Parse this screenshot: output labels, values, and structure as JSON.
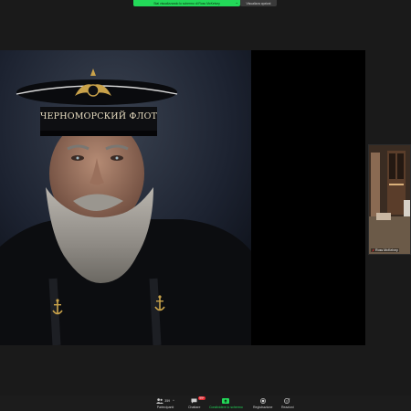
{
  "share_bar": {
    "banner_text": "Stai visualizzando lo schermo di Ross McKelvey",
    "view_options_label": "Visualizza opzioni"
  },
  "shared_content": {
    "cap_text": "ЧЕРНОМОРСКИЙ ФЛОТ"
  },
  "participant": {
    "name": "Ross McKelvey",
    "mic_muted": true
  },
  "toolbar": {
    "participants_label": "Partecipanti",
    "participants_count": "359",
    "chat_label": "Chattare",
    "chat_badge": "99+",
    "share_label": "Condividere lo schermo",
    "record_label": "Registrazione",
    "reactions_label": "Reazioni"
  },
  "colors": {
    "accent_green": "#23d959",
    "badge_red": "#e0282f",
    "background": "#1a1a1a"
  }
}
